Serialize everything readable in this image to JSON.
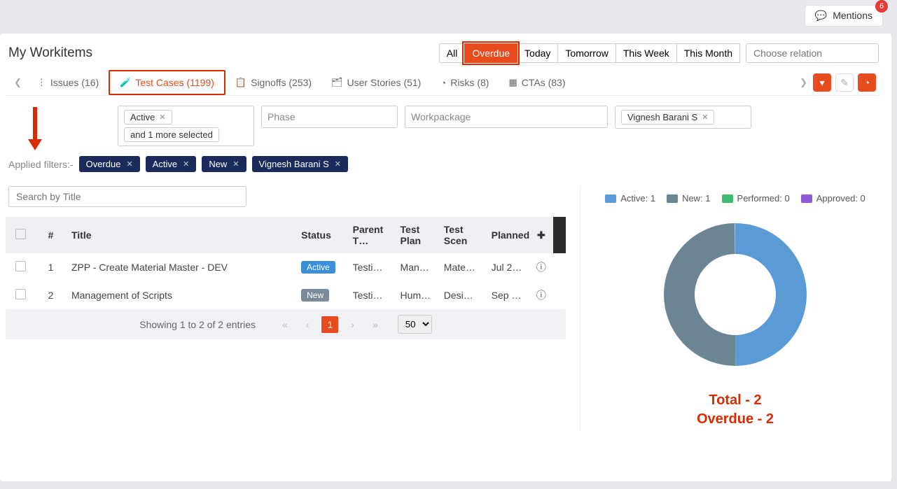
{
  "topbar": {
    "mentions_label": "Mentions",
    "mentions_count": "6"
  },
  "page_title": "My Workitems",
  "time_tabs": [
    "All",
    "Overdue",
    "Today",
    "Tomorrow",
    "This Week",
    "This Month"
  ],
  "time_tabs_active": "Overdue",
  "relation_placeholder": "Choose relation",
  "workitem_tabs": [
    {
      "icon": "⋮",
      "label": "Issues (16)"
    },
    {
      "icon": "⚗",
      "label": "Test Cases (1199)",
      "active": true
    },
    {
      "icon": "⬚",
      "label": "Signoffs (253)"
    },
    {
      "icon": "▤",
      "label": "User Stories (51)"
    },
    {
      "icon": "◔",
      "label": "Risks (8)"
    },
    {
      "icon": "▦",
      "label": "CTAs (83)"
    }
  ],
  "filter_boxes": {
    "status": {
      "selected": "Active",
      "more": "and 1 more selected"
    },
    "phase_placeholder": "Phase",
    "workpackage_placeholder": "Workpackage",
    "user": {
      "selected": "Vignesh Barani S"
    }
  },
  "applied_label": "Applied filters:-",
  "applied_chips": [
    "Overdue",
    "Active",
    "New",
    "Vignesh Barani S"
  ],
  "search_placeholder": "Search by Title",
  "table": {
    "headers": [
      "#",
      "Title",
      "Status",
      "Parent T…",
      "Test Plan",
      "Test Scen",
      "Planned"
    ],
    "rows": [
      {
        "num": "1",
        "title": "ZPP - Create Material Master - DEV",
        "status": "Active",
        "parent": "Testi…",
        "plan": "Man…",
        "scen": "Mate…",
        "planned": "Jul 2…"
      },
      {
        "num": "2",
        "title": "Management of Scripts",
        "status": "New",
        "parent": "Testi…",
        "plan": "Hum…",
        "scen": "Desi…",
        "planned": "Sep …"
      }
    ]
  },
  "pager": {
    "info": "Showing 1 to 2 of 2 entries",
    "current": "1",
    "size": "50"
  },
  "chart_data": {
    "type": "pie",
    "title": "",
    "series": [
      {
        "name": "Active",
        "value": 1,
        "color": "#5a9bd5"
      },
      {
        "name": "New",
        "value": 1,
        "color": "#6b8593"
      },
      {
        "name": "Performed",
        "value": 0,
        "color": "#3fb972"
      },
      {
        "name": "Approved",
        "value": 0,
        "color": "#8e5bd6"
      }
    ],
    "legend": [
      "Active: 1",
      "New: 1",
      "Performed: 0",
      "Approved: 0"
    ]
  },
  "totals": {
    "line1": "Total - 2",
    "line2": "Overdue - 2"
  }
}
